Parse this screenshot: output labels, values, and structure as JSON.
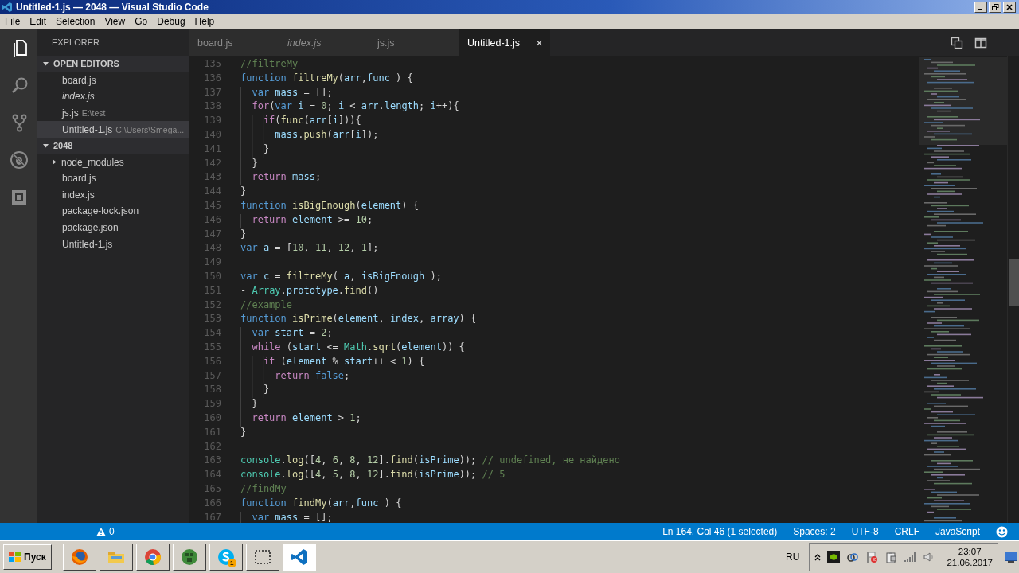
{
  "window": {
    "title": "Untitled-1.js — 2048 — Visual Studio Code"
  },
  "menu": [
    "File",
    "Edit",
    "Selection",
    "View",
    "Go",
    "Debug",
    "Help"
  ],
  "activity_bar": [
    {
      "kind": "explorer",
      "selected": true
    },
    {
      "kind": "search",
      "selected": false
    },
    {
      "kind": "git",
      "selected": false
    },
    {
      "kind": "debug",
      "selected": false
    },
    {
      "kind": "extensions",
      "selected": false
    }
  ],
  "sidebar": {
    "title": "EXPLORER",
    "sections": [
      {
        "title": "OPEN EDITORS",
        "expanded": true,
        "items": [
          {
            "kind": "file",
            "name": "board.js",
            "preview": false,
            "selected": false
          },
          {
            "kind": "file",
            "name": "index.js",
            "preview": true,
            "selected": false
          },
          {
            "kind": "file",
            "name": "js.js",
            "description": "E:\\test",
            "preview": false,
            "selected": false
          },
          {
            "kind": "file",
            "name": "Untitled-1.js",
            "description": "C:\\Users\\Smega...",
            "preview": false,
            "selected": true
          }
        ]
      },
      {
        "title": "2048",
        "expanded": true,
        "items": [
          {
            "kind": "folder",
            "name": "node_modules",
            "expanded": false,
            "selected": false
          },
          {
            "kind": "file",
            "name": "board.js",
            "selected": false
          },
          {
            "kind": "file",
            "name": "index.js",
            "selected": false
          },
          {
            "kind": "file",
            "name": "package-lock.json",
            "selected": false
          },
          {
            "kind": "file",
            "name": "package.json",
            "selected": false
          },
          {
            "kind": "file",
            "name": "Untitled-1.js",
            "selected": false
          }
        ]
      }
    ]
  },
  "tabs": [
    {
      "label": "board.js",
      "preview": false,
      "selected": false
    },
    {
      "label": "index.js",
      "preview": true,
      "selected": false
    },
    {
      "label": "js.js",
      "preview": false,
      "selected": false
    },
    {
      "label": "Untitled-1.js",
      "preview": false,
      "selected": true,
      "close": "×"
    }
  ],
  "editor": {
    "lines": [
      {
        "number": "135",
        "tokens": [
          {
            "kind": "comment",
            "text": "//filtreMy"
          }
        ]
      },
      {
        "number": "136",
        "tokens": [
          {
            "kind": "keyword",
            "text": "function "
          },
          {
            "kind": "function",
            "text": "filtreMy"
          },
          {
            "kind": "plain",
            "text": "("
          },
          {
            "kind": "variable",
            "text": "arr"
          },
          {
            "kind": "plain",
            "text": ","
          },
          {
            "kind": "variable",
            "text": "func"
          },
          {
            "kind": "plain",
            "text": " ) {"
          }
        ]
      },
      {
        "number": "137",
        "tokens": [
          {
            "kind": "keyword",
            "text": "  var "
          },
          {
            "kind": "variable",
            "text": "mass"
          },
          {
            "kind": "plain",
            "text": " = [];"
          }
        ]
      },
      {
        "number": "138",
        "tokens": [
          {
            "kind": "control",
            "text": "  for"
          },
          {
            "kind": "plain",
            "text": "("
          },
          {
            "kind": "keyword",
            "text": "var "
          },
          {
            "kind": "variable",
            "text": "i"
          },
          {
            "kind": "plain",
            "text": " = "
          },
          {
            "kind": "number",
            "text": "0"
          },
          {
            "kind": "plain",
            "text": "; "
          },
          {
            "kind": "variable",
            "text": "i"
          },
          {
            "kind": "plain",
            "text": " < "
          },
          {
            "kind": "variable",
            "text": "arr"
          },
          {
            "kind": "plain",
            "text": "."
          },
          {
            "kind": "variable",
            "text": "length"
          },
          {
            "kind": "plain",
            "text": "; "
          },
          {
            "kind": "variable",
            "text": "i"
          },
          {
            "kind": "plain",
            "text": "++){"
          }
        ]
      },
      {
        "number": "139",
        "tokens": [
          {
            "kind": "control",
            "text": "    if"
          },
          {
            "kind": "plain",
            "text": "("
          },
          {
            "kind": "function",
            "text": "func"
          },
          {
            "kind": "plain",
            "text": "("
          },
          {
            "kind": "variable",
            "text": "arr"
          },
          {
            "kind": "plain",
            "text": "["
          },
          {
            "kind": "variable",
            "text": "i"
          },
          {
            "kind": "plain",
            "text": "])){"
          }
        ]
      },
      {
        "number": "140",
        "tokens": [
          {
            "kind": "variable",
            "text": "      mass"
          },
          {
            "kind": "plain",
            "text": "."
          },
          {
            "kind": "function",
            "text": "push"
          },
          {
            "kind": "plain",
            "text": "("
          },
          {
            "kind": "variable",
            "text": "arr"
          },
          {
            "kind": "plain",
            "text": "["
          },
          {
            "kind": "variable",
            "text": "i"
          },
          {
            "kind": "plain",
            "text": "]);"
          }
        ]
      },
      {
        "number": "141",
        "tokens": [
          {
            "kind": "plain",
            "text": "    }"
          }
        ]
      },
      {
        "number": "142",
        "tokens": [
          {
            "kind": "plain",
            "text": "  }"
          }
        ]
      },
      {
        "number": "143",
        "tokens": [
          {
            "kind": "control",
            "text": "  return "
          },
          {
            "kind": "variable",
            "text": "mass"
          },
          {
            "kind": "plain",
            "text": ";"
          }
        ]
      },
      {
        "number": "144",
        "tokens": [
          {
            "kind": "plain",
            "text": "}"
          }
        ]
      },
      {
        "number": "145",
        "tokens": [
          {
            "kind": "keyword",
            "text": "function "
          },
          {
            "kind": "function",
            "text": "isBigEnough"
          },
          {
            "kind": "plain",
            "text": "("
          },
          {
            "kind": "variable",
            "text": "element"
          },
          {
            "kind": "plain",
            "text": ") {"
          }
        ]
      },
      {
        "number": "146",
        "tokens": [
          {
            "kind": "control",
            "text": "  return "
          },
          {
            "kind": "variable",
            "text": "element"
          },
          {
            "kind": "plain",
            "text": " >= "
          },
          {
            "kind": "number",
            "text": "10"
          },
          {
            "kind": "plain",
            "text": ";"
          }
        ]
      },
      {
        "number": "147",
        "tokens": [
          {
            "kind": "plain",
            "text": "}"
          }
        ]
      },
      {
        "number": "148",
        "tokens": [
          {
            "kind": "keyword",
            "text": "var "
          },
          {
            "kind": "variable",
            "text": "a"
          },
          {
            "kind": "plain",
            "text": " = ["
          },
          {
            "kind": "number",
            "text": "10"
          },
          {
            "kind": "plain",
            "text": ", "
          },
          {
            "kind": "number",
            "text": "11"
          },
          {
            "kind": "plain",
            "text": ", "
          },
          {
            "kind": "number",
            "text": "12"
          },
          {
            "kind": "plain",
            "text": ", "
          },
          {
            "kind": "number",
            "text": "1"
          },
          {
            "kind": "plain",
            "text": "];"
          }
        ]
      },
      {
        "number": "149"
      },
      {
        "number": "150",
        "tokens": [
          {
            "kind": "keyword",
            "text": "var "
          },
          {
            "kind": "variable",
            "text": "c"
          },
          {
            "kind": "plain",
            "text": " = "
          },
          {
            "kind": "function",
            "text": "filtreMy"
          },
          {
            "kind": "plain",
            "text": "( "
          },
          {
            "kind": "variable",
            "text": "a"
          },
          {
            "kind": "plain",
            "text": ", "
          },
          {
            "kind": "variable",
            "text": "isBigEnough"
          },
          {
            "kind": "plain",
            "text": " );"
          }
        ]
      },
      {
        "number": "151",
        "tokens": [
          {
            "kind": "plain",
            "text": "- "
          },
          {
            "kind": "type",
            "text": "Array"
          },
          {
            "kind": "plain",
            "text": "."
          },
          {
            "kind": "variable",
            "text": "prototype"
          },
          {
            "kind": "plain",
            "text": "."
          },
          {
            "kind": "function",
            "text": "find"
          },
          {
            "kind": "plain",
            "text": "()"
          }
        ]
      },
      {
        "number": "152",
        "tokens": [
          {
            "kind": "comment",
            "text": "//example"
          }
        ]
      },
      {
        "number": "153",
        "tokens": [
          {
            "kind": "keyword",
            "text": "function "
          },
          {
            "kind": "function",
            "text": "isPrime"
          },
          {
            "kind": "plain",
            "text": "("
          },
          {
            "kind": "variable",
            "text": "element"
          },
          {
            "kind": "plain",
            "text": ", "
          },
          {
            "kind": "variable",
            "text": "index"
          },
          {
            "kind": "plain",
            "text": ", "
          },
          {
            "kind": "variable",
            "text": "array"
          },
          {
            "kind": "plain",
            "text": ") {"
          }
        ]
      },
      {
        "number": "154",
        "tokens": [
          {
            "kind": "keyword",
            "text": "  var "
          },
          {
            "kind": "variable",
            "text": "start"
          },
          {
            "kind": "plain",
            "text": " = "
          },
          {
            "kind": "number",
            "text": "2"
          },
          {
            "kind": "plain",
            "text": ";"
          }
        ]
      },
      {
        "number": "155",
        "tokens": [
          {
            "kind": "control",
            "text": "  while "
          },
          {
            "kind": "plain",
            "text": "("
          },
          {
            "kind": "variable",
            "text": "start"
          },
          {
            "kind": "plain",
            "text": " <= "
          },
          {
            "kind": "type",
            "text": "Math"
          },
          {
            "kind": "plain",
            "text": "."
          },
          {
            "kind": "function",
            "text": "sqrt"
          },
          {
            "kind": "plain",
            "text": "("
          },
          {
            "kind": "variable",
            "text": "element"
          },
          {
            "kind": "plain",
            "text": ")) {"
          }
        ]
      },
      {
        "number": "156",
        "tokens": [
          {
            "kind": "control",
            "text": "    if "
          },
          {
            "kind": "plain",
            "text": "("
          },
          {
            "kind": "variable",
            "text": "element"
          },
          {
            "kind": "plain",
            "text": " % "
          },
          {
            "kind": "variable",
            "text": "start"
          },
          {
            "kind": "plain",
            "text": "++ < "
          },
          {
            "kind": "number",
            "text": "1"
          },
          {
            "kind": "plain",
            "text": ") {"
          }
        ]
      },
      {
        "number": "157",
        "tokens": [
          {
            "kind": "control",
            "text": "      return "
          },
          {
            "kind": "keyword",
            "text": "false"
          },
          {
            "kind": "plain",
            "text": ";"
          }
        ]
      },
      {
        "number": "158",
        "tokens": [
          {
            "kind": "plain",
            "text": "    }"
          }
        ]
      },
      {
        "number": "159",
        "tokens": [
          {
            "kind": "plain",
            "text": "  }"
          }
        ]
      },
      {
        "number": "160",
        "tokens": [
          {
            "kind": "control",
            "text": "  return "
          },
          {
            "kind": "variable",
            "text": "element"
          },
          {
            "kind": "plain",
            "text": " > "
          },
          {
            "kind": "number",
            "text": "1"
          },
          {
            "kind": "plain",
            "text": ";"
          }
        ]
      },
      {
        "number": "161",
        "tokens": [
          {
            "kind": "plain",
            "text": "}"
          }
        ]
      },
      {
        "number": "162"
      },
      {
        "number": "163",
        "tokens": [
          {
            "kind": "type",
            "text": "console"
          },
          {
            "kind": "plain",
            "text": "."
          },
          {
            "kind": "function",
            "text": "log"
          },
          {
            "kind": "plain",
            "text": "(["
          },
          {
            "kind": "number",
            "text": "4"
          },
          {
            "kind": "plain",
            "text": ", "
          },
          {
            "kind": "number",
            "text": "6"
          },
          {
            "kind": "plain",
            "text": ", "
          },
          {
            "kind": "number",
            "text": "8"
          },
          {
            "kind": "plain",
            "text": ", "
          },
          {
            "kind": "number",
            "text": "12"
          },
          {
            "kind": "plain",
            "text": "]."
          },
          {
            "kind": "function",
            "text": "find"
          },
          {
            "kind": "plain",
            "text": "("
          },
          {
            "kind": "variable",
            "text": "isPrime"
          },
          {
            "kind": "plain",
            "text": ")); "
          },
          {
            "kind": "comment",
            "text": "// undefined, не найдено"
          }
        ]
      },
      {
        "number": "164",
        "tokens": [
          {
            "kind": "type",
            "text": "console"
          },
          {
            "kind": "plain",
            "text": "."
          },
          {
            "kind": "function",
            "text": "log"
          },
          {
            "kind": "plain",
            "text": "(["
          },
          {
            "kind": "number",
            "text": "4"
          },
          {
            "kind": "plain",
            "text": ", "
          },
          {
            "kind": "number",
            "text": "5"
          },
          {
            "kind": "plain",
            "text": ", "
          },
          {
            "kind": "number",
            "text": "8"
          },
          {
            "kind": "plain",
            "text": ", "
          },
          {
            "kind": "number",
            "text": "12"
          },
          {
            "kind": "plain",
            "text": "]."
          },
          {
            "kind": "function",
            "text": "find"
          },
          {
            "kind": "plain",
            "text": "("
          },
          {
            "kind": "variable",
            "text": "isPrime"
          },
          {
            "kind": "plain",
            "text": ")); "
          },
          {
            "kind": "comment",
            "text": "// 5"
          }
        ]
      },
      {
        "number": "165",
        "tokens": [
          {
            "kind": "comment",
            "text": "//findMy"
          }
        ]
      },
      {
        "number": "166",
        "tokens": [
          {
            "kind": "keyword",
            "text": "function "
          },
          {
            "kind": "function",
            "text": "findMy"
          },
          {
            "kind": "plain",
            "text": "("
          },
          {
            "kind": "variable",
            "text": "arr"
          },
          {
            "kind": "plain",
            "text": ","
          },
          {
            "kind": "variable",
            "text": "func"
          },
          {
            "kind": "plain",
            "text": " ) {"
          }
        ]
      },
      {
        "number": "167",
        "tokens": [
          {
            "kind": "keyword",
            "text": "  var "
          },
          {
            "kind": "variable",
            "text": "mass"
          },
          {
            "kind": "plain",
            "text": " = [];"
          }
        ]
      }
    ]
  },
  "status_bar": {
    "warnings": "0",
    "items": [
      "Ln 164, Col 46 (1 selected)",
      "Spaces: 2",
      "UTF-8",
      "CRLF",
      "JavaScript"
    ]
  },
  "taskbar": {
    "start": "Пуск",
    "apps": [
      {
        "kind": "firefox",
        "selected": false
      },
      {
        "kind": "explorer",
        "selected": false
      },
      {
        "kind": "chrome",
        "selected": false
      },
      {
        "kind": "globe",
        "selected": false
      },
      {
        "kind": "skype",
        "selected": false,
        "badge": "1"
      },
      {
        "kind": "snipping",
        "selected": false
      },
      {
        "kind": "vscode",
        "selected": true
      }
    ],
    "language": "RU",
    "time": "23:07",
    "date": "21.06.2017"
  }
}
